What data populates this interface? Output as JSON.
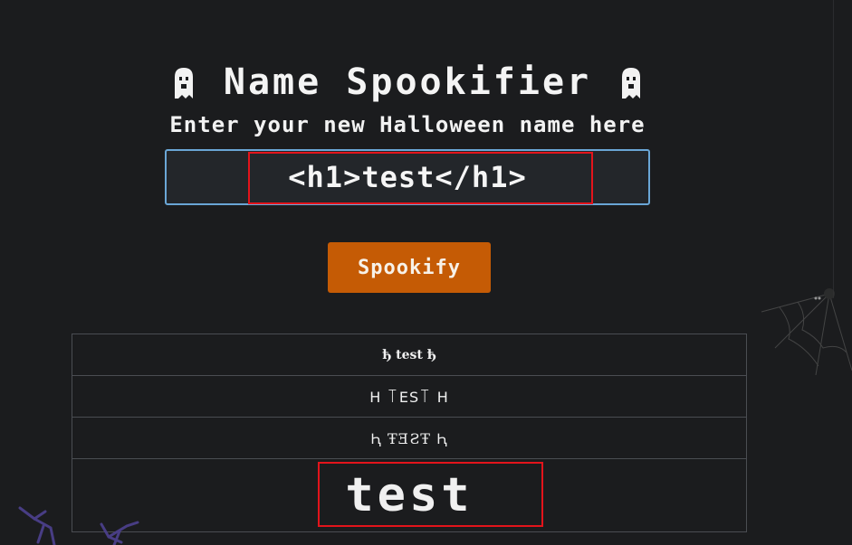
{
  "header": {
    "title": "Name Spookifier",
    "subtitle": "Enter your new Halloween name here"
  },
  "input": {
    "value": "<h1>test</h1>",
    "placeholder": ""
  },
  "button": {
    "label": "Spookify"
  },
  "results": {
    "rows": [
      "ђ  test  ђ",
      "Н  ꓄ꓰꓢ꓄  Н",
      "Ԧ  ŦƎƧŦ  Ԧ",
      "test"
    ]
  },
  "icons": {
    "left": "ghost-icon",
    "right": "ghost-icon",
    "decor_right": "spider-web-icon",
    "decor_bottom_left": "branch-icon"
  },
  "colors": {
    "background": "#1b1c1e",
    "button": "#c55b05",
    "input_border": "#6aa6d6",
    "highlight": "#e3141b",
    "table_border": "#4a4d52"
  }
}
